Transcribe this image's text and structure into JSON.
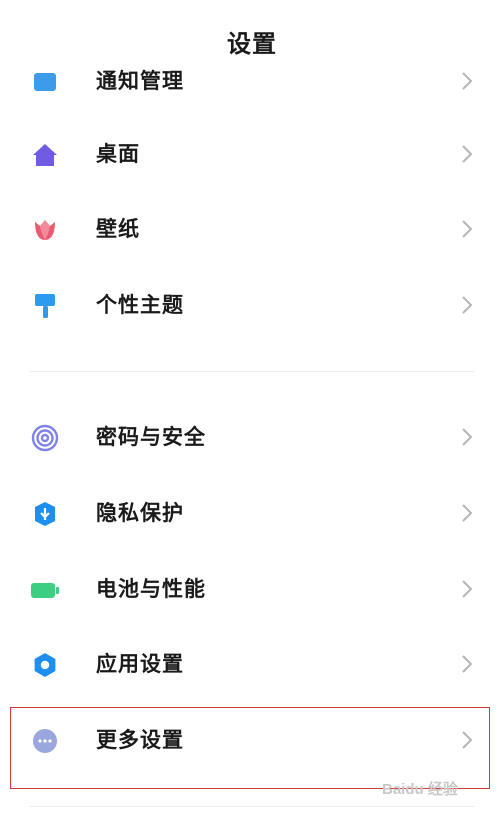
{
  "header": {
    "title": "设置"
  },
  "items": [
    {
      "key": "notifications",
      "label": "通知管理"
    },
    {
      "key": "desktop",
      "label": "桌面"
    },
    {
      "key": "wallpaper",
      "label": "壁纸"
    },
    {
      "key": "themes",
      "label": "个性主题"
    },
    {
      "key": "password",
      "label": "密码与安全"
    },
    {
      "key": "privacy",
      "label": "隐私保护"
    },
    {
      "key": "battery",
      "label": "电池与性能"
    },
    {
      "key": "apps",
      "label": "应用设置"
    },
    {
      "key": "more",
      "label": "更多设置"
    }
  ],
  "watermark": {
    "text": "Baidu 经验"
  },
  "colors": {
    "notifications": "#3d9be9",
    "desktop": "#6f5ce0",
    "wallpaper": "#ea5a72",
    "themes": "#2a9bf0",
    "password": "#7f83e6",
    "privacy": "#1e8ff0",
    "battery": "#3ccf82",
    "apps": "#1e8ff0",
    "more": "#9aa6de",
    "highlight_border": "#d23a3a"
  },
  "icons": {
    "notifications": "notification-icon",
    "desktop": "home-icon",
    "wallpaper": "tulip-icon",
    "themes": "paint-roller-icon",
    "password": "fingerprint-icon",
    "privacy": "shield-icon",
    "battery": "battery-icon",
    "apps": "gear-icon",
    "more": "more-dots-icon"
  }
}
